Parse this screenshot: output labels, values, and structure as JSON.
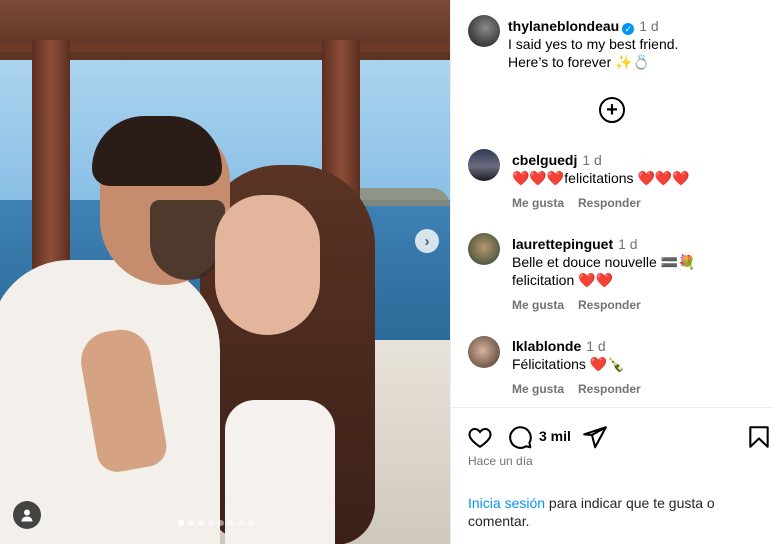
{
  "post": {
    "username": "thylaneblondeau",
    "verified_mark": "✓",
    "time": "1 d",
    "caption_line1": "I said yes to my best friend.",
    "caption_line2": "Here’s to forever ✨💍",
    "carousel_total": 8,
    "carousel_active": 1
  },
  "comments": [
    {
      "username": "cbelguedj",
      "time": "1 d",
      "text_line1": "❤️❤️❤️felicitations ❤️❤️❤️",
      "text_line2": "",
      "like_label": "Me gusta",
      "reply_label": "Responder"
    },
    {
      "username": "laurettepinguet",
      "time": "1 d",
      "text_line1": "Belle et douce nouvelle 🟰💐",
      "text_line2": "felicitation ❤️❤️",
      "like_label": "Me gusta",
      "reply_label": "Responder"
    },
    {
      "username": "lklablonde",
      "time": "1 d",
      "text_line1": "Félicitations ❤️🍾",
      "text_line2": "",
      "like_label": "Me gusta",
      "reply_label": "Responder"
    }
  ],
  "actions": {
    "comment_count": "3 mil",
    "posted_ago": "Hace un día"
  },
  "login_prompt": {
    "link": "Inicia sesión",
    "text": " para indicar que te gusta o comentar."
  },
  "icons": {
    "load_more": "+",
    "next": "›"
  }
}
